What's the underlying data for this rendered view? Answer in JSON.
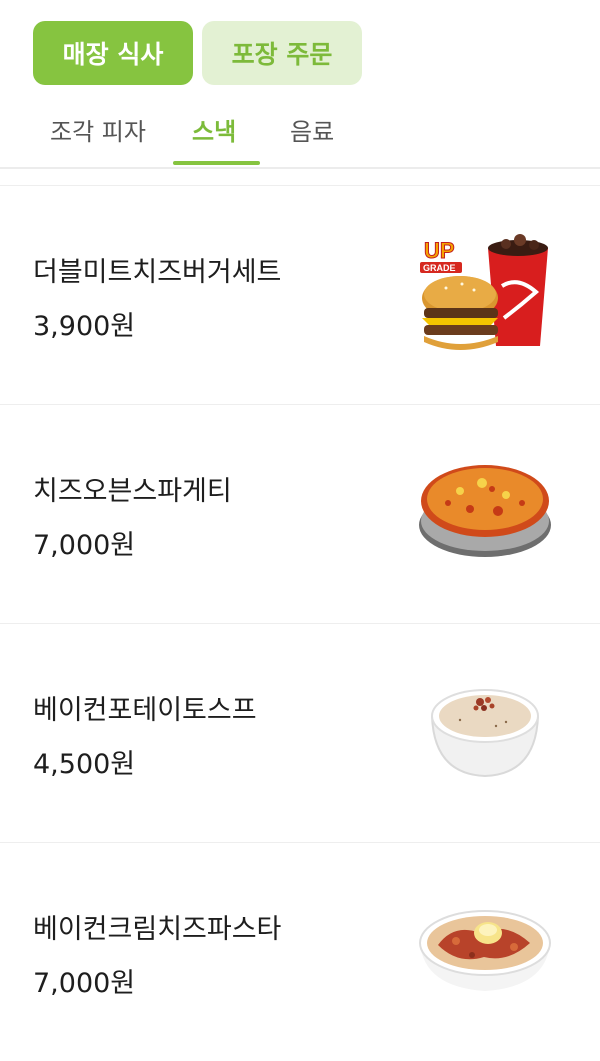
{
  "order_toggle": {
    "dine_in": "매장 식사",
    "takeout": "포장 주문"
  },
  "tabs": [
    {
      "label": "조각 피자",
      "active": false
    },
    {
      "label": "스낵",
      "active": true
    },
    {
      "label": "음료",
      "active": false
    }
  ],
  "items": [
    {
      "name": "더블미트치즈버거세트",
      "price": "3,900원",
      "image": "burger-set-image",
      "badge_line1": "UP",
      "badge_line2": "GRADE"
    },
    {
      "name": "치즈오븐스파게티",
      "price": "7,000원",
      "image": "cheese-spaghetti-image"
    },
    {
      "name": "베이컨포테이토스프",
      "price": "4,500원",
      "image": "potato-soup-image"
    },
    {
      "name": "베이컨크림치즈파스타",
      "price": "7,000원",
      "image": "cream-pasta-image"
    }
  ],
  "colors": {
    "accent": "#86c440",
    "accent_light": "#e3f1d3",
    "text": "#1e1e1e"
  }
}
